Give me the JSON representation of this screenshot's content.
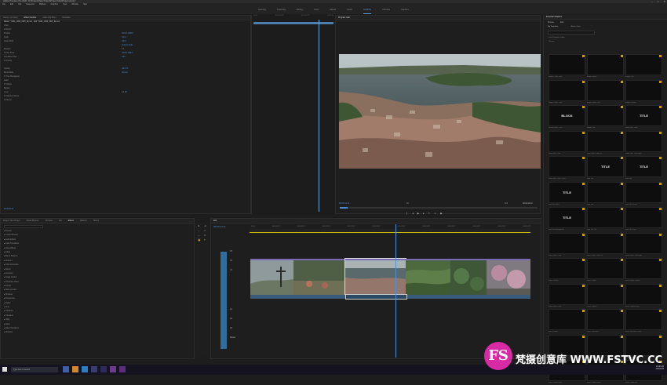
{
  "window": {
    "title": "Adobe Premiere Pro 2020 - D:\\Projects\\New Project\\Project Files\\Project.prproj *",
    "controls": [
      "–",
      "□",
      "✕"
    ]
  },
  "menu": [
    "File",
    "Edit",
    "Clip",
    "Sequence",
    "Markers",
    "Graphics",
    "View",
    "Window",
    "Help"
  ],
  "workspaces": {
    "items": [
      "Learning",
      "Assembly",
      "Editing",
      "Color",
      "Effects",
      "Audio",
      "Graphics",
      "Libraries",
      "Captions"
    ],
    "active": "Graphics"
  },
  "effect_controls": {
    "tabs": [
      "Source: (no clips)",
      "Effect Controls",
      "Audio Clip Mixer",
      "Metadata"
    ],
    "active": "Effect Controls",
    "clip": "Master * A001_C002_0915_IE.mov",
    "sequence": "Edit * A001_C002_0915_IE.mov",
    "section": "Video",
    "rows": [
      {
        "label": "fx Motion",
        "value": ""
      },
      {
        "label": "Position",
        "value": "1920.0  1080.0"
      },
      {
        "label": "Scale",
        "value": "100.0"
      },
      {
        "label": "Scale Width",
        "value": "100.0"
      },
      {
        "label": "",
        "value": "Uniform Scale"
      },
      {
        "label": "Rotation",
        "value": "0.0"
      },
      {
        "label": "Anchor Point",
        "value": "1920.0  1080.0"
      },
      {
        "label": "Anti-flicker Filter",
        "value": "0.00"
      },
      {
        "label": "fx Opacity",
        "value": ""
      },
      {
        "label": "",
        "value": ""
      },
      {
        "label": "Opacity",
        "value": "100.0 %"
      },
      {
        "label": "Blend Mode",
        "value": "Normal"
      },
      {
        "label": "fx Time Remapping",
        "value": ""
      },
      {
        "label": "Audio",
        "value": ""
      },
      {
        "label": "fx Volume",
        "value": ""
      },
      {
        "label": "Bypass",
        "value": ""
      },
      {
        "label": "Level",
        "value": "0.0 dB"
      },
      {
        "label": "fx Channel Volume",
        "value": ""
      },
      {
        "label": "fx Panner",
        "value": ""
      }
    ],
    "timecode": "00:00:00:00",
    "time_marks": [
      "00:00",
      "00:00:04:23",
      "00:00:09:23",
      "00:00:14"
    ]
  },
  "program": {
    "tabs": [
      "Program: Edit"
    ],
    "timecode": "00:00:14:11",
    "fit": "Fit",
    "full": "Full",
    "duration": "00:01:29:12"
  },
  "essential_graphics": {
    "title": "Essential Graphics",
    "tabs": [
      "Browse",
      "Edit"
    ],
    "subtabs": [
      "My Templates",
      "Adobe Stock"
    ],
    "checks": [
      "Local Templates Folder",
      "Libraries"
    ],
    "items": [
      {
        "label": "Angled Lower Third",
        "text": ""
      },
      {
        "label": "Angles Subtle",
        "text": ""
      },
      {
        "label": "Angled Title",
        "text": ""
      },
      {
        "label": "Angles Lower Third",
        "text": ""
      },
      {
        "label": "Angles Subtle Title",
        "text": ""
      },
      {
        "label": "Angled Subtitle",
        "text": ""
      },
      {
        "label": "Blocks Lower Third",
        "text": "BLOCK"
      },
      {
        "label": "Angled Title",
        "text": ""
      },
      {
        "label": "Bold Lower Third",
        "text": "TITLE"
      },
      {
        "label": "Bold Lower Third",
        "text": ""
      },
      {
        "label": "Bold Lower Third Left",
        "text": ""
      },
      {
        "label": "Bold Lower Third Right",
        "text": ""
      },
      {
        "label": "Bold Lower Third Center",
        "text": ""
      },
      {
        "label": "Bold Title",
        "text": "TITLE"
      },
      {
        "label": "Bold Title",
        "text": "TITLE"
      },
      {
        "label": "Bold Title Right",
        "text": "TITLE"
      },
      {
        "label": "Bold Title",
        "text": ""
      },
      {
        "label": "Bold Title To Left",
        "text": ""
      },
      {
        "label": "Bold Title Background",
        "text": "TITLE"
      },
      {
        "label": "Bold Title Left",
        "text": ""
      },
      {
        "label": "Bold Title Right",
        "text": ""
      },
      {
        "label": "Basic Lower Third",
        "text": ""
      },
      {
        "label": "Basic Lower Third Left",
        "text": ""
      },
      {
        "label": "Basic Lower Third Right",
        "text": ""
      },
      {
        "label": "Basic Overlay",
        "text": ""
      },
      {
        "label": "Basic Credits",
        "text": ""
      },
      {
        "label": "Basic Image Caption",
        "text": ""
      },
      {
        "label": "Basic Lower Third",
        "text": ""
      },
      {
        "label": "Basic Caption",
        "text": ""
      },
      {
        "label": "Basic Caption Right",
        "text": ""
      },
      {
        "label": "Bars Counter",
        "text": ""
      },
      {
        "label": "Basic Color Bars",
        "text": ""
      },
      {
        "label": "Basic Tag Lower Third",
        "text": ""
      },
      {
        "label": "Basic Title",
        "text": ""
      },
      {
        "label": "Basic Callout",
        "text": ""
      },
      {
        "label": "Basic Callout Left",
        "text": ""
      },
      {
        "label": "Basic Callout Right",
        "text": ""
      },
      {
        "label": "Basic Callout Down",
        "text": ""
      },
      {
        "label": "Basic Callout Up",
        "text": ""
      }
    ]
  },
  "project": {
    "tabs": [
      "Project: New Project",
      "Media Browser",
      "Libraries",
      "Info",
      "Effects",
      "Markers",
      "History"
    ],
    "active": "Effects",
    "tree": [
      "Presets",
      "Lumetri Presets",
      "Audio Effects",
      "Audio Transitions",
      "Video Effects",
      "Adjust",
      "Blur & Sharpen",
      "Channel",
      "Color Correction",
      "Distort",
      "Generate",
      "Image Control",
      "Immersive Video",
      "Keying",
      "Noise & Grain",
      "Obsolete",
      "Perspective",
      "Stylize",
      "Time",
      "Transform",
      "Transition",
      "Utility",
      "Video",
      "Video Transitions",
      "Obsolete"
    ]
  },
  "timeline": {
    "title": "Edit",
    "timecode": "00:00:14:11",
    "ruler": [
      "00:00",
      "00:00:04:23",
      "00:00:09:23",
      "00:00:14:23",
      "00:00:19:23",
      "00:00:24:23",
      "00:00:29:23",
      "00:00:34:23",
      "00:00:39:22",
      "00:00:44:22",
      "00:00:49:22",
      "00:00:54:22"
    ],
    "tracks": [
      "V3",
      "V2",
      "V1",
      "A1",
      "A2",
      "A3",
      "Master"
    ]
  },
  "taskbar": {
    "search": "Type here to search",
    "time": "10:48 AM",
    "date": "11/6/2019"
  },
  "watermark": {
    "logo": "FS",
    "text": "梵摄创意库 WWW.FSTVC.CC"
  },
  "colors": {
    "accent": "#5b9bd5",
    "clip": "#7a6ab5",
    "playhead": "#4c90d8"
  }
}
